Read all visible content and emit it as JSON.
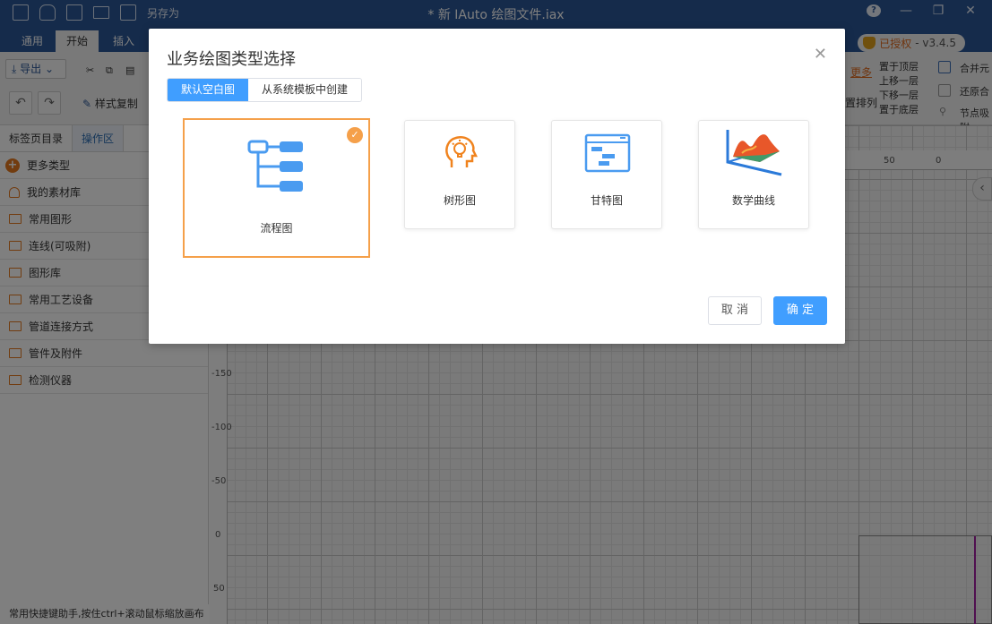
{
  "window": {
    "title": "* 新 IAuto 绘图文件.iax",
    "save_as": "另存为"
  },
  "ribbon_tabs": [
    "通用",
    "开始",
    "插入"
  ],
  "license": {
    "text": "已授权",
    "version": "- v3.4.5"
  },
  "ribbon": {
    "export_label": "导出",
    "format_copy": "样式复制",
    "more_label": "更多",
    "arrange_label": "置排列",
    "layer": [
      "置于顶层",
      "上移一层",
      "下移一层",
      "置于底层"
    ],
    "merge": "合并元",
    "restore": "还原合",
    "node_snap": "节点吸附"
  },
  "left_panel": {
    "tabs": [
      "标签页目录",
      "操作区"
    ],
    "more_types": "更多类型",
    "items": [
      "我的素材库",
      "常用图形",
      "连线(可吸附)",
      "图形库",
      "常用工艺设备",
      "管道连接方式",
      "管件及附件",
      "检测仪器"
    ],
    "footer": "常用快捷键助手,按住ctrl+滚动鼠标缩放画布"
  },
  "ruler": {
    "top": [
      "50",
      "0"
    ],
    "left": [
      "-150",
      "-100",
      "-50",
      "0",
      "50"
    ]
  },
  "dialog": {
    "title": "业务绘图类型选择",
    "segments": [
      "默认空白图",
      "从系统模板中创建"
    ],
    "cards": [
      "流程图",
      "树形图",
      "甘特图",
      "数学曲线"
    ],
    "cancel": "取 消",
    "ok": "确 定"
  },
  "colors": {
    "titlebar": "#2b5797",
    "primary": "#409eff",
    "selected_border": "#f5a04a",
    "icon_blue": "#4a9bf0",
    "icon_orange": "#f0831e"
  }
}
